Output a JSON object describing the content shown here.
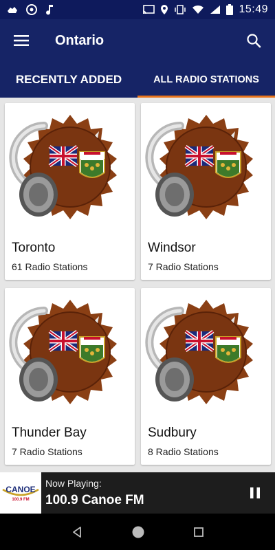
{
  "status_bar": {
    "time": "15:49",
    "left_icons": [
      "cloud-icon",
      "photo-icon",
      "music-icon"
    ],
    "right_icons": [
      "cast-icon",
      "location-icon",
      "vibrate-icon",
      "wifi-icon",
      "signal-icon",
      "battery-icon"
    ]
  },
  "app_bar": {
    "title": "Ontario",
    "menu_icon": "hamburger-menu-icon",
    "search_icon": "search-icon"
  },
  "tabs": [
    {
      "label": "RECENTLY ADDED",
      "active": false
    },
    {
      "label": "ALL RADIO STATIONS",
      "active": true
    }
  ],
  "cards": [
    {
      "title": "Toronto",
      "subtitle": "61 Radio Stations"
    },
    {
      "title": "Windsor",
      "subtitle": "7 Radio Stations"
    },
    {
      "title": "Thunder Bay",
      "subtitle": "7 Radio Stations"
    },
    {
      "title": "Sudbury",
      "subtitle": "8 Radio Stations"
    }
  ],
  "player": {
    "label": "Now Playing:",
    "station": "100.9 Canoe FM",
    "logo_text": "CANOE",
    "logo_sub": "100.9 FM"
  },
  "nav": [
    "back-icon",
    "home-icon",
    "recents-icon"
  ],
  "colors": {
    "primary": "#162466",
    "status": "#0e1a5c",
    "accent": "#e8741c",
    "player_bg": "#1d1d1d"
  }
}
